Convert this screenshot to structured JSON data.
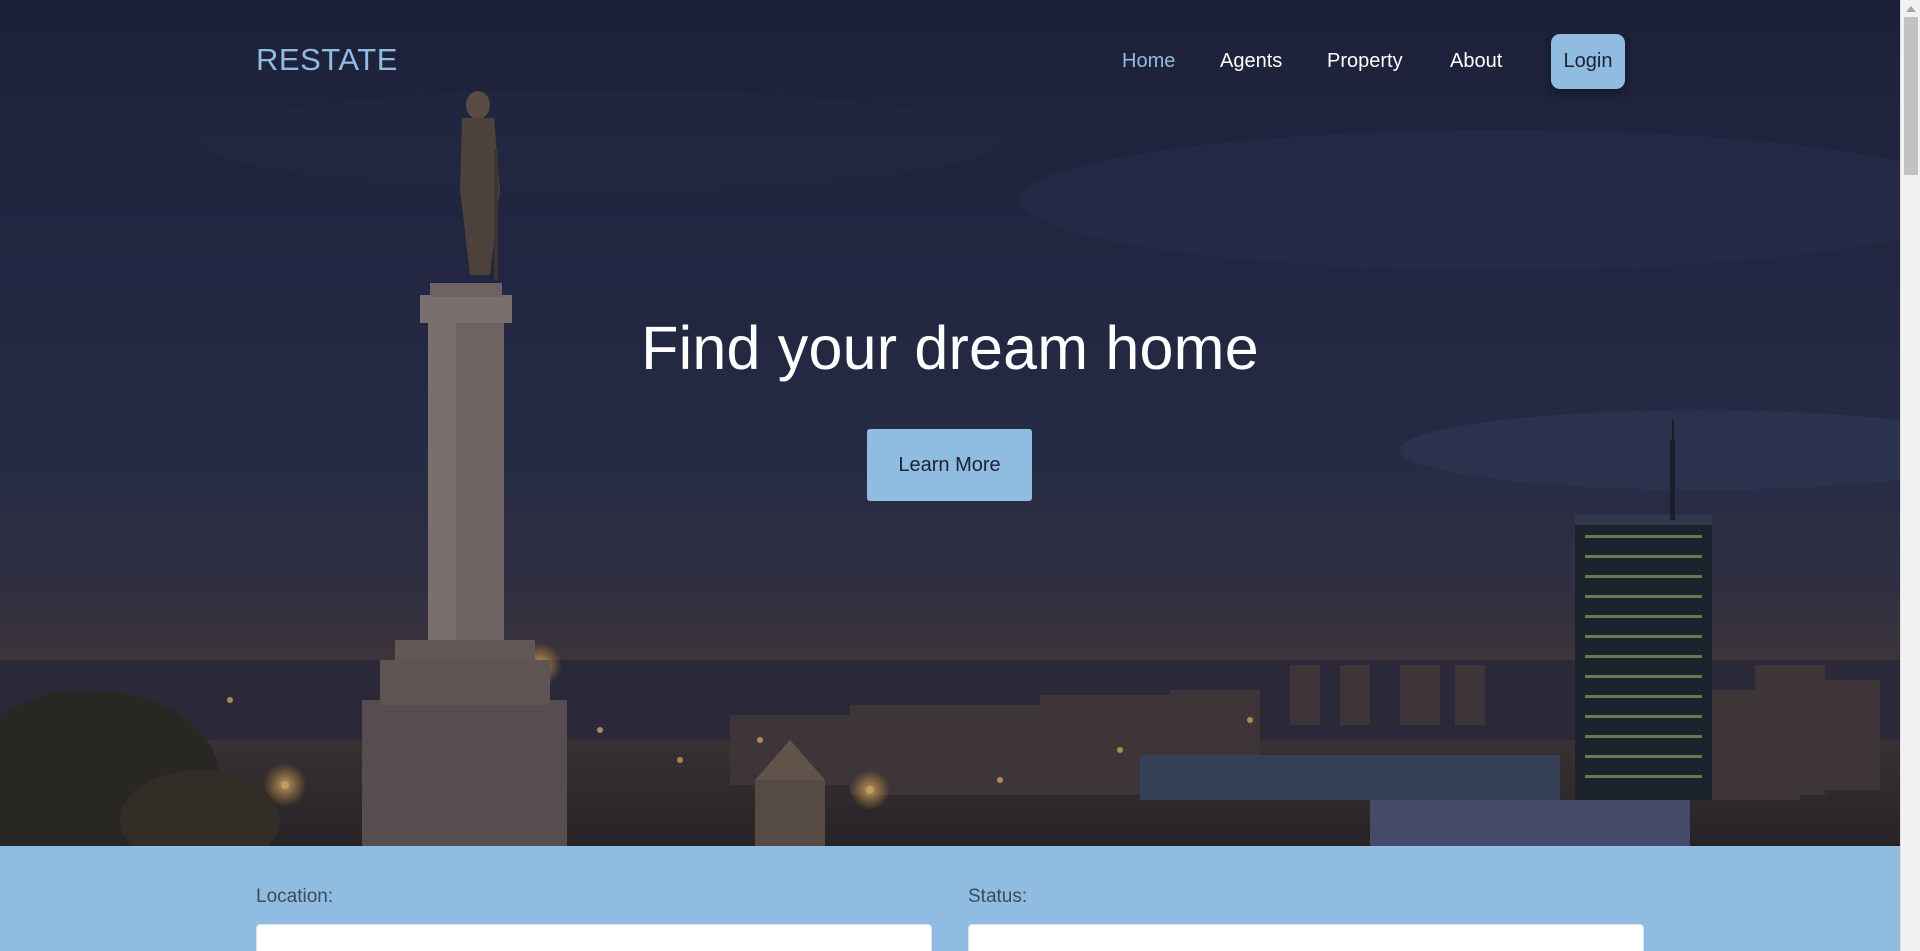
{
  "brand": {
    "logo_text": "RESTATE"
  },
  "nav": {
    "items": [
      {
        "label": "Home",
        "active": true
      },
      {
        "label": "Agents",
        "active": false
      },
      {
        "label": "Property",
        "active": false
      },
      {
        "label": "About",
        "active": false
      }
    ],
    "login_label": "Login"
  },
  "hero": {
    "headline": "Find your dream home",
    "cta_label": "Learn More"
  },
  "search": {
    "location_label": "Location:",
    "location_value": "",
    "status_label": "Status:",
    "status_value": ""
  },
  "colors": {
    "accent": "#8fbce0",
    "hero_overlay": "#1d2138",
    "text_light": "#ffffff"
  }
}
